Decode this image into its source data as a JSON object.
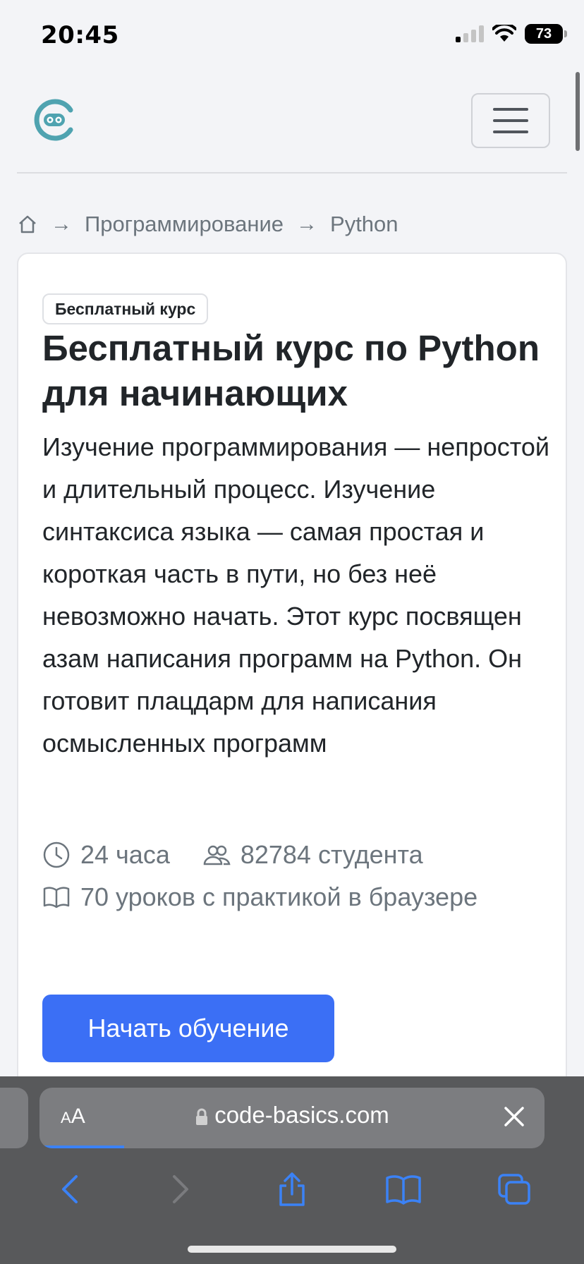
{
  "status_bar": {
    "time": "20:45",
    "battery": "73"
  },
  "breadcrumb": {
    "category": "Программирование",
    "current": "Python"
  },
  "course": {
    "badge": "Бесплатный курс",
    "title": "Бесплатный курс по Python для начинающих",
    "description": "Изучение программирования — непростой и длительный процесс. Изучение синтаксиса языка — самая простая и короткая часть в пути, но без неё невозможно начать. Этот курс посвящен азам написания программ на Python. Он готовит плацдарм для написания осмысленных программ",
    "duration": "24 часа",
    "students": "82784 студента",
    "lessons": "70 уроков с практикой в браузере",
    "cta_label": "Начать обучение"
  },
  "browser": {
    "aa_label": "AA",
    "url": "code-basics.com"
  },
  "colors": {
    "accent": "#3b6ff5",
    "logo": "#4fa3b0"
  }
}
